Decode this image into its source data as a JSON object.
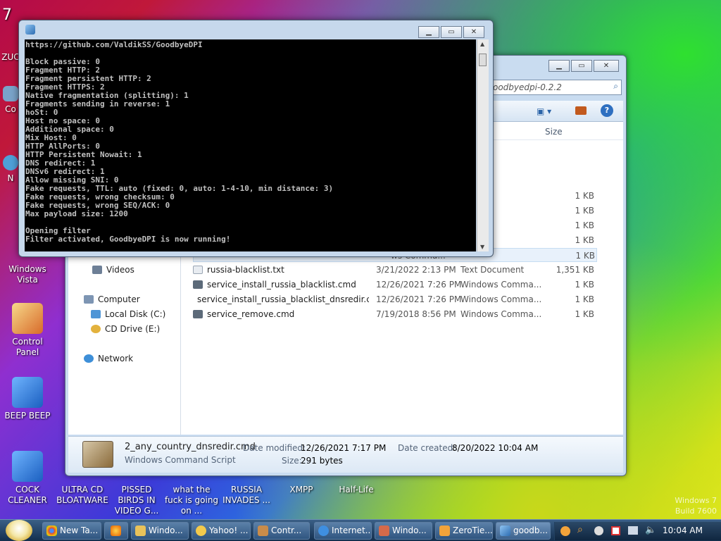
{
  "desktop": {
    "top_labels": [
      "7",
      "ZUC"
    ],
    "icons": [
      {
        "label": "Co"
      },
      {
        "label": "N"
      },
      {
        "label": "Windows Vista"
      },
      {
        "label": "Control Panel"
      },
      {
        "label": "BEEP BEEP"
      },
      {
        "label": "COCK CLEANER"
      },
      {
        "label": "ULTRA CD BLOATWARE"
      },
      {
        "label": "PISSED BIRDS IN VIDEO G..."
      },
      {
        "label": "what the fuck is going on ..."
      },
      {
        "label": "RUSSIA INVADES ..."
      },
      {
        "label": "XMPP"
      },
      {
        "label": "Half-Life"
      }
    ],
    "watermark": {
      "line1": "Windows 7",
      "line2": "Build 7600"
    }
  },
  "console": {
    "lines": [
      "https://github.com/ValdikSS/GoodbyeDPI",
      "",
      "Block passive: 0",
      "Fragment HTTP: 2",
      "Fragment persistent HTTP: 2",
      "Fragment HTTPS: 2",
      "Native fragmentation (splitting): 1",
      "Fragments sending in reverse: 1",
      "hoSt: 0",
      "Host no space: 0",
      "Additional space: 0",
      "Mix Host: 0",
      "HTTP AllPorts: 0",
      "HTTP Persistent Nowait: 1",
      "DNS redirect: 1",
      "DNSv6 redirect: 1",
      "Allow missing SNI: 0",
      "Fake requests, TTL: auto (fixed: 0, auto: 1-4-10, min distance: 3)",
      "Fake requests, wrong checksum: 0",
      "Fake requests, wrong SEQ/ACK: 0",
      "Max payload size: 1200",
      "",
      "Opening filter",
      "Filter activated, GoodbyeDPI is now running!"
    ]
  },
  "explorer": {
    "address": "oodbyedpi-0.2.2",
    "column_size": "Size",
    "nav": {
      "videos": "Videos",
      "computer": "Computer",
      "local_disk": "Local Disk (C:)",
      "cd_drive": "CD Drive (E:)",
      "network": "Network"
    },
    "partial_rows": [
      {
        "type": "er",
        "size": ""
      },
      {
        "type": "er",
        "size": ""
      },
      {
        "type": "er",
        "size": ""
      },
      {
        "type": "ws Comma...",
        "size": "1 KB"
      },
      {
        "type": "ws Comma...",
        "size": "1 KB"
      },
      {
        "type": "ws Comma...",
        "size": "1 KB"
      },
      {
        "type": "ws Comma...",
        "size": "1 KB"
      },
      {
        "type": "ws Comma...",
        "size": "1 KB"
      }
    ],
    "rows": [
      {
        "name": "russia-blacklist.txt",
        "date": "3/21/2022 2:13 PM",
        "type": "Text Document",
        "size": "1,351 KB"
      },
      {
        "name": "service_install_russia_blacklist.cmd",
        "date": "12/26/2021 7:26 PM",
        "type": "Windows Comma...",
        "size": "1 KB"
      },
      {
        "name": "service_install_russia_blacklist_dnsredir.c...",
        "date": "12/26/2021 7:26 PM",
        "type": "Windows Comma...",
        "size": "1 KB"
      },
      {
        "name": "service_remove.cmd",
        "date": "7/19/2018 8:56 PM",
        "type": "Windows Comma...",
        "size": "1 KB"
      }
    ],
    "details": {
      "filename": "2_any_country_dnsredir.cmd",
      "filetype": "Windows Command Script",
      "date_modified_label": "Date modified:",
      "date_modified": "12/26/2021 7:17 PM",
      "date_created_label": "Date created:",
      "date_created": "8/20/2022 10:04 AM",
      "size_label": "Size:",
      "size": "291 bytes"
    }
  },
  "taskbar": {
    "buttons": [
      "New Ta...",
      "Windo...",
      "Yahoo! ...",
      "Contr...",
      "Internet...",
      "Windo...",
      "ZeroTie...",
      "goodb..."
    ],
    "clock": "10:04 AM"
  }
}
